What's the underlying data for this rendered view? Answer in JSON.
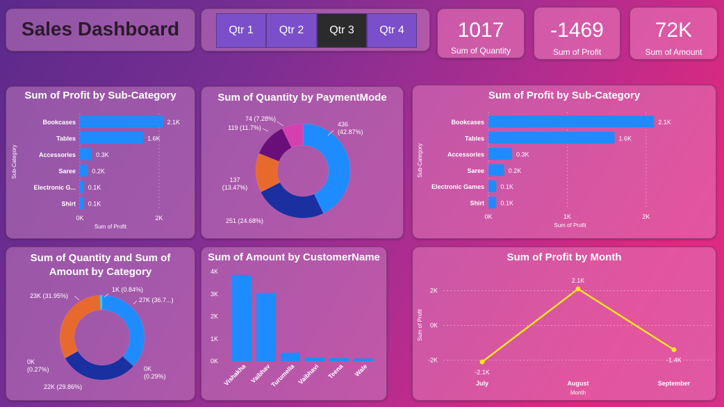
{
  "header": {
    "title": "Sales Dashboard"
  },
  "slicer": {
    "items": [
      "Qtr 1",
      "Qtr 2",
      "Qtr 3",
      "Qtr 4"
    ],
    "selected": "Qtr 3"
  },
  "kpis": [
    {
      "value": "1017",
      "label": "Sum of Quantity"
    },
    {
      "value": "-1469",
      "label": "Sum of Profit"
    },
    {
      "value": "72K",
      "label": "Sum of Amount"
    }
  ],
  "colors": {
    "bar": "#1e8cff",
    "line": "#f2e51f",
    "donut": [
      "#1e8cff",
      "#1a2fa0",
      "#e8692e",
      "#6a0f7a",
      "#d63fb0"
    ]
  },
  "chart_data": [
    {
      "type": "bar",
      "orientation": "horizontal",
      "title": "Sum of Profit by Sub-Category",
      "categories": [
        "Bookcases",
        "Tables",
        "Accessories",
        "Saree",
        "Electronic G...",
        "Shirt"
      ],
      "values": [
        2100,
        1600,
        300,
        200,
        100,
        100
      ],
      "data_labels": [
        "2.1K",
        "1.6K",
        "0.3K",
        "0.2K",
        "0.1K",
        "0.1K"
      ],
      "xlabel": "Sum of Profit",
      "ylabel": "Sub-Category",
      "xticks": [
        "0K",
        "2K"
      ],
      "xlim": [
        0,
        2600
      ]
    },
    {
      "type": "pie",
      "subtype": "donut",
      "title": "Sum of Quantity by PaymentMode",
      "values": [
        436,
        251,
        137,
        119,
        74
      ],
      "labels": [
        "436\n(42.87%)",
        "251 (24.68%)",
        "137\n(13.47%)",
        "119 (11.7%)",
        "74 (7.28%)"
      ]
    },
    {
      "type": "bar",
      "orientation": "horizontal",
      "title": "Sum of Profit by Sub-Category",
      "categories": [
        "Bookcases",
        "Tables",
        "Accessories",
        "Saree",
        "Electronic Games",
        "Shirt"
      ],
      "values": [
        2100,
        1600,
        300,
        200,
        100,
        100
      ],
      "data_labels": [
        "2.1K",
        "1.6K",
        "0.3K",
        "0.2K",
        "0.1K",
        "0.1K"
      ],
      "xlabel": "Sum of Profit",
      "ylabel": "Sub-Category",
      "xticks": [
        "0K",
        "1K",
        "2K"
      ],
      "xlim": [
        0,
        2600
      ]
    },
    {
      "type": "pie",
      "subtype": "donut",
      "title": "Sum of Quantity and Sum of Amount by Category",
      "values": [
        36.7,
        0.29,
        29.86,
        0.27,
        31.95,
        0.84
      ],
      "labels": [
        "27K (36.7...)",
        "0K\n(0.29%)",
        "22K (29.86%)",
        "0K\n(0.27%)",
        "23K (31.95%)",
        "1K (0.84%)"
      ]
    },
    {
      "type": "bar",
      "orientation": "vertical",
      "title": "Sum of Amount by CustomerName",
      "categories": [
        "Vishakha",
        "Vaibhav",
        "Turumella",
        "Vaibhavi",
        "Teena",
        "Wale"
      ],
      "values": [
        3850,
        3050,
        380,
        160,
        140,
        120
      ],
      "yticks": [
        "0K",
        "1K",
        "2K",
        "3K",
        "4K"
      ],
      "ylim": [
        0,
        4000
      ]
    },
    {
      "type": "line",
      "title": "Sum of Profit by Month",
      "categories": [
        "July",
        "August",
        "September"
      ],
      "values": [
        -2100,
        2100,
        -1400
      ],
      "data_labels": [
        "-2.1K",
        "2.1K",
        "-1.4K"
      ],
      "xlabel": "Month",
      "ylabel": "Sum of Profit",
      "yticks": [
        "2K",
        "0K",
        "-2K"
      ],
      "ylim": [
        -2700,
        2900
      ]
    }
  ]
}
